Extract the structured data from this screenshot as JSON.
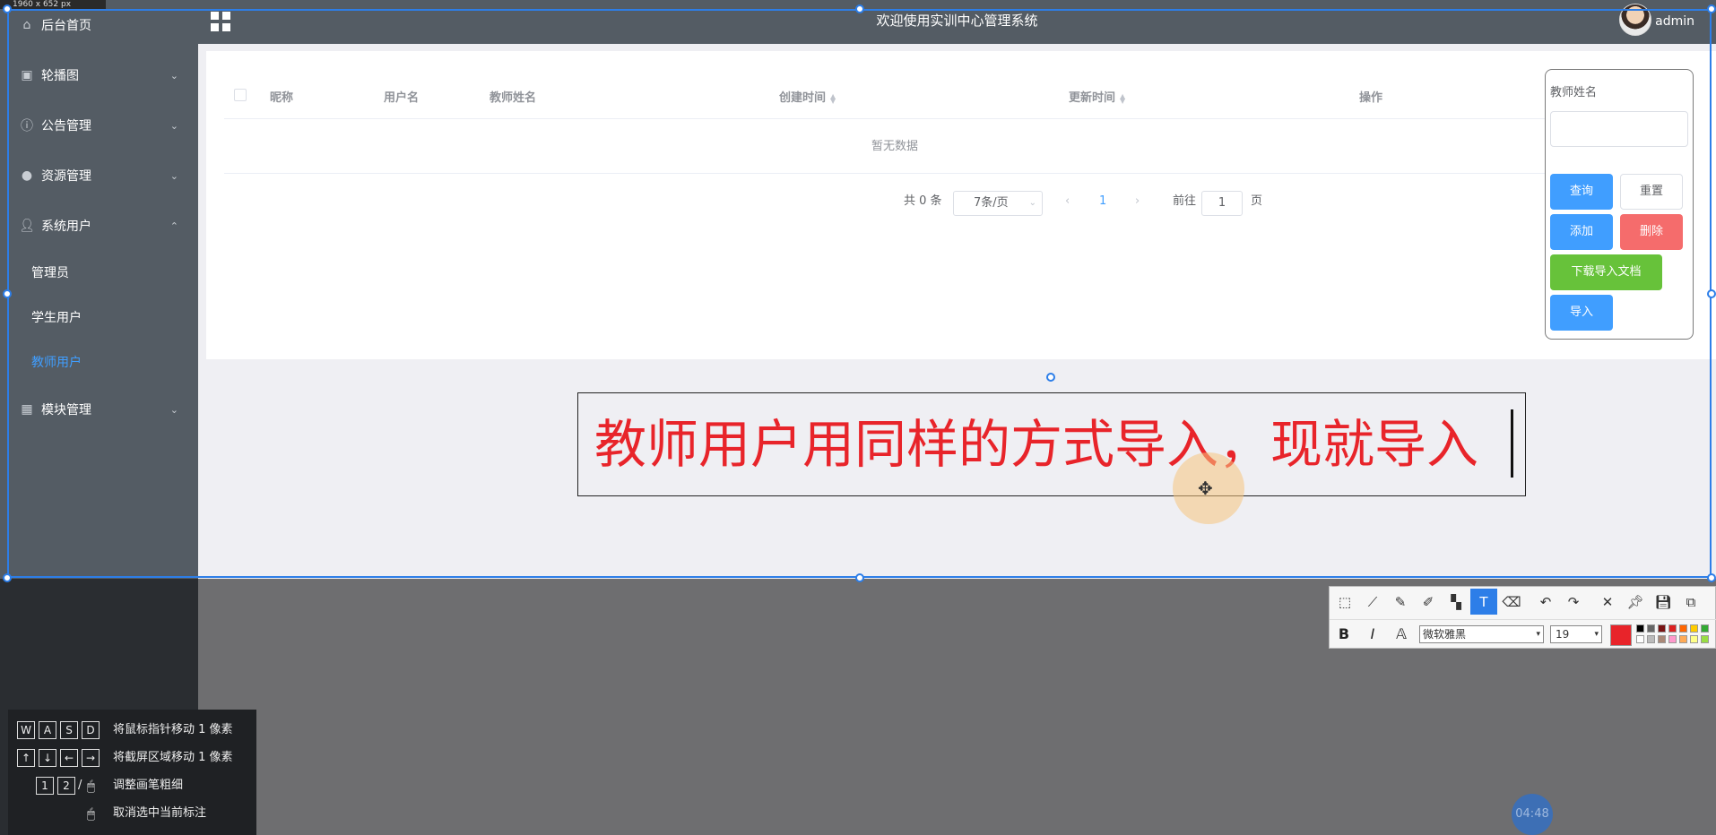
{
  "topbar": {
    "title": "欢迎使用实训中心管理系统",
    "user": "admin"
  },
  "sidebar": {
    "items": [
      {
        "label": "后台首页",
        "icon": "home-icon"
      },
      {
        "label": "轮播图",
        "icon": "image-icon"
      },
      {
        "label": "公告管理",
        "icon": "info-icon"
      },
      {
        "label": "资源管理",
        "icon": "location-icon"
      },
      {
        "label": "系统用户",
        "icon": "user-icon"
      },
      {
        "label": "模块管理",
        "icon": "grid-icon"
      }
    ],
    "sub_items": [
      {
        "label": "管理员"
      },
      {
        "label": "学生用户"
      },
      {
        "label": "教师用户",
        "active": true
      }
    ]
  },
  "table": {
    "columns": [
      "昵称",
      "用户名",
      "教师姓名",
      "创建时间",
      "更新时间",
      "操作"
    ],
    "empty_text": "暂无数据"
  },
  "pagination": {
    "total": "共 0 条",
    "page_size": "7条/页",
    "current_page": "1",
    "goto_label": "前往",
    "goto_value": "1",
    "page_unit": "页"
  },
  "search_panel": {
    "label": "教师姓名",
    "buttons": {
      "query": "查询",
      "reset": "重置",
      "add": "添加",
      "delete": "删除",
      "download": "下载导入文档",
      "import": "导入"
    }
  },
  "annotation": {
    "text": "教师用户用同样的方式导入，现就导入"
  },
  "capture": {
    "size_label": "1960 x 652 px"
  },
  "toolbar": {
    "font": "微软雅黑",
    "font_size": "19",
    "current_color": "#e8242a"
  },
  "help": {
    "rows": [
      {
        "keys": [
          "W",
          "A",
          "S",
          "D"
        ],
        "label": "将鼠标指针移动 1 像素"
      },
      {
        "keys": [
          "↑",
          "↓",
          "←",
          "→"
        ],
        "label": "将截屏区域移动 1 像素"
      },
      {
        "keys": [
          "1",
          "2"
        ],
        "label": "调整画笔粗细"
      },
      {
        "keys": [],
        "label": "取消选中当前标注"
      }
    ]
  },
  "timer": "04:48",
  "colors": {
    "accent": "#409eff",
    "sidebar_bg": "#545c64",
    "danger": "#f56c6c",
    "success": "#67c23a",
    "annotation": "#e8242a"
  }
}
